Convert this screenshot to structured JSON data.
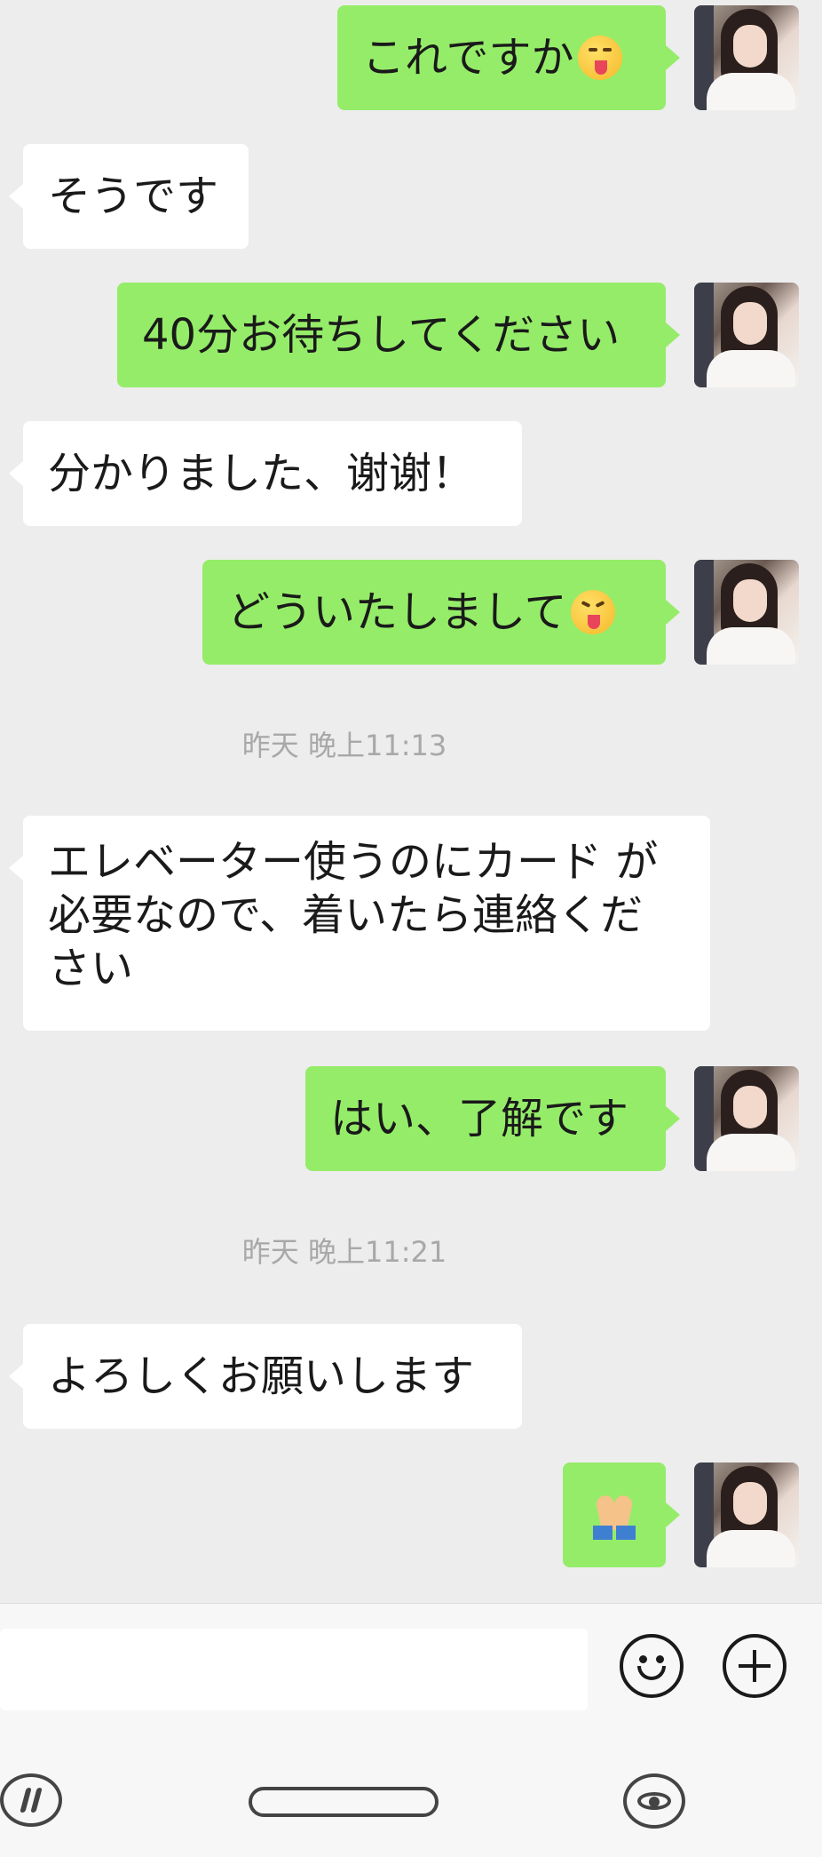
{
  "messages": [
    {
      "from": "me",
      "text": "これですか",
      "emoji": "winking-face-with-tongue-icon"
    },
    {
      "from": "them",
      "text": "そうです"
    },
    {
      "from": "me",
      "text": "40分お待ちしてください"
    },
    {
      "from": "them",
      "text": "分かりました、谢谢！"
    },
    {
      "from": "me",
      "text": "どういたしまして",
      "emoji": "squinting-face-with-tongue-icon"
    },
    {
      "from": "them",
      "lines": [
        "エレベーター使うのにカード が",
        "必要なので、着いたら連絡くだ",
        "さい"
      ]
    },
    {
      "from": "me",
      "text": "はい、了解です"
    },
    {
      "from": "them",
      "text": "よろしくお願いします"
    },
    {
      "from": "me",
      "emoji": "folded-hands-icon"
    }
  ],
  "timestamps": [
    "昨天 晚上11:13",
    "昨天 晚上11:21"
  ],
  "input": {
    "value": "",
    "placeholder": ""
  },
  "colors": {
    "sent_bubble": "#95ec69",
    "received_bubble": "#ffffff",
    "background": "#ededed",
    "timestamp_text": "#a8a8a8"
  },
  "toolbar": {
    "emoji_icon": "smiley-face-icon",
    "plus_icon": "plus-circle-icon"
  },
  "navigation": {
    "left_icon": "app-logo-icon",
    "home_icon": "home-pill-icon",
    "right_icon": "eye-icon"
  }
}
